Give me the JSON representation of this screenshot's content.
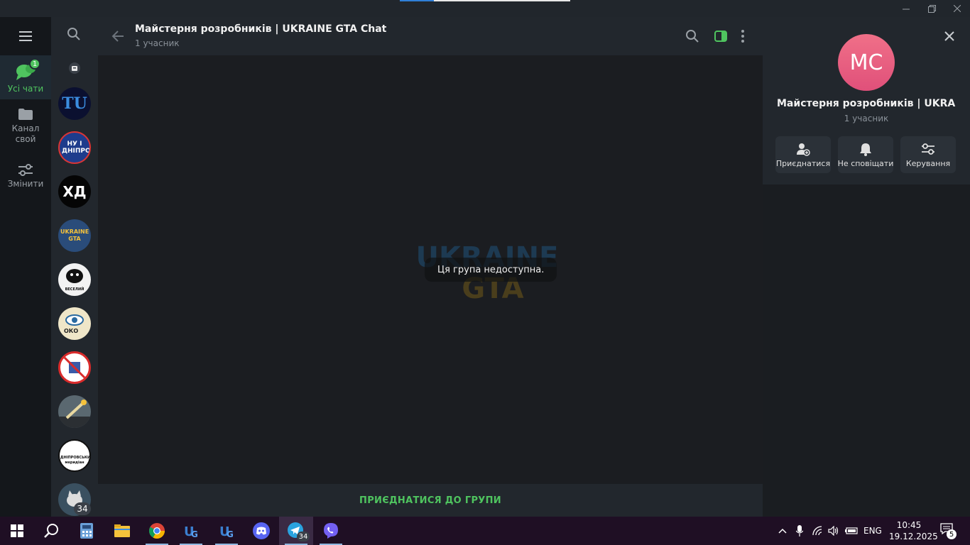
{
  "folders": {
    "all_chats": {
      "label": "Усі чати",
      "badge": "1"
    },
    "channel": {
      "label": "Канал свой"
    },
    "edit": {
      "label": "Змінити"
    }
  },
  "chat_list": {
    "avatars": [
      {
        "name": "TU",
        "text": "TU"
      },
      {
        "name": "Ну і Дніпро",
        "text": "НУ І ДНІПРО"
      },
      {
        "name": "ХД",
        "text": "ХД"
      },
      {
        "name": "Ukraine GTA",
        "text": "UKRAINE GTA"
      },
      {
        "name": "Веселий",
        "text": "ВЕСЕЛИЙ"
      },
      {
        "name": "ОКО",
        "text": "ОКО"
      },
      {
        "name": "Forbidden",
        "text": ""
      },
      {
        "name": "Rocket",
        "text": ""
      },
      {
        "name": "Дніпровський меридіан",
        "text": "ДНІПРОВСЬКИЙ меридіан"
      },
      {
        "name": "Cat",
        "text": ""
      }
    ],
    "unread_badge": "34"
  },
  "chat": {
    "title": "Майстерня розробників | UKRAINE GTA Chat",
    "subtitle": "1 учасник",
    "unavailable_message": "Ця група недоступна.",
    "watermark_line1": "UKRAINE",
    "watermark_line2": "GTA",
    "join_button": "ПРИЄДНАТИСЯ ДО ГРУПИ"
  },
  "info_panel": {
    "avatar_initials": "MC",
    "title": "Майстерня розробників | UKRAI...",
    "subtitle": "1 учасник",
    "actions": {
      "join": "Приєднатися",
      "mute": "Не сповіщати",
      "manage": "Керування"
    }
  },
  "taskbar": {
    "telegram_badge": "34",
    "language": "ENG",
    "time": "10:45",
    "date": "19.12.2025",
    "notifications": "5"
  },
  "colors": {
    "accent_green": "#4fc45f",
    "avatar_pink": "#e0507a"
  }
}
